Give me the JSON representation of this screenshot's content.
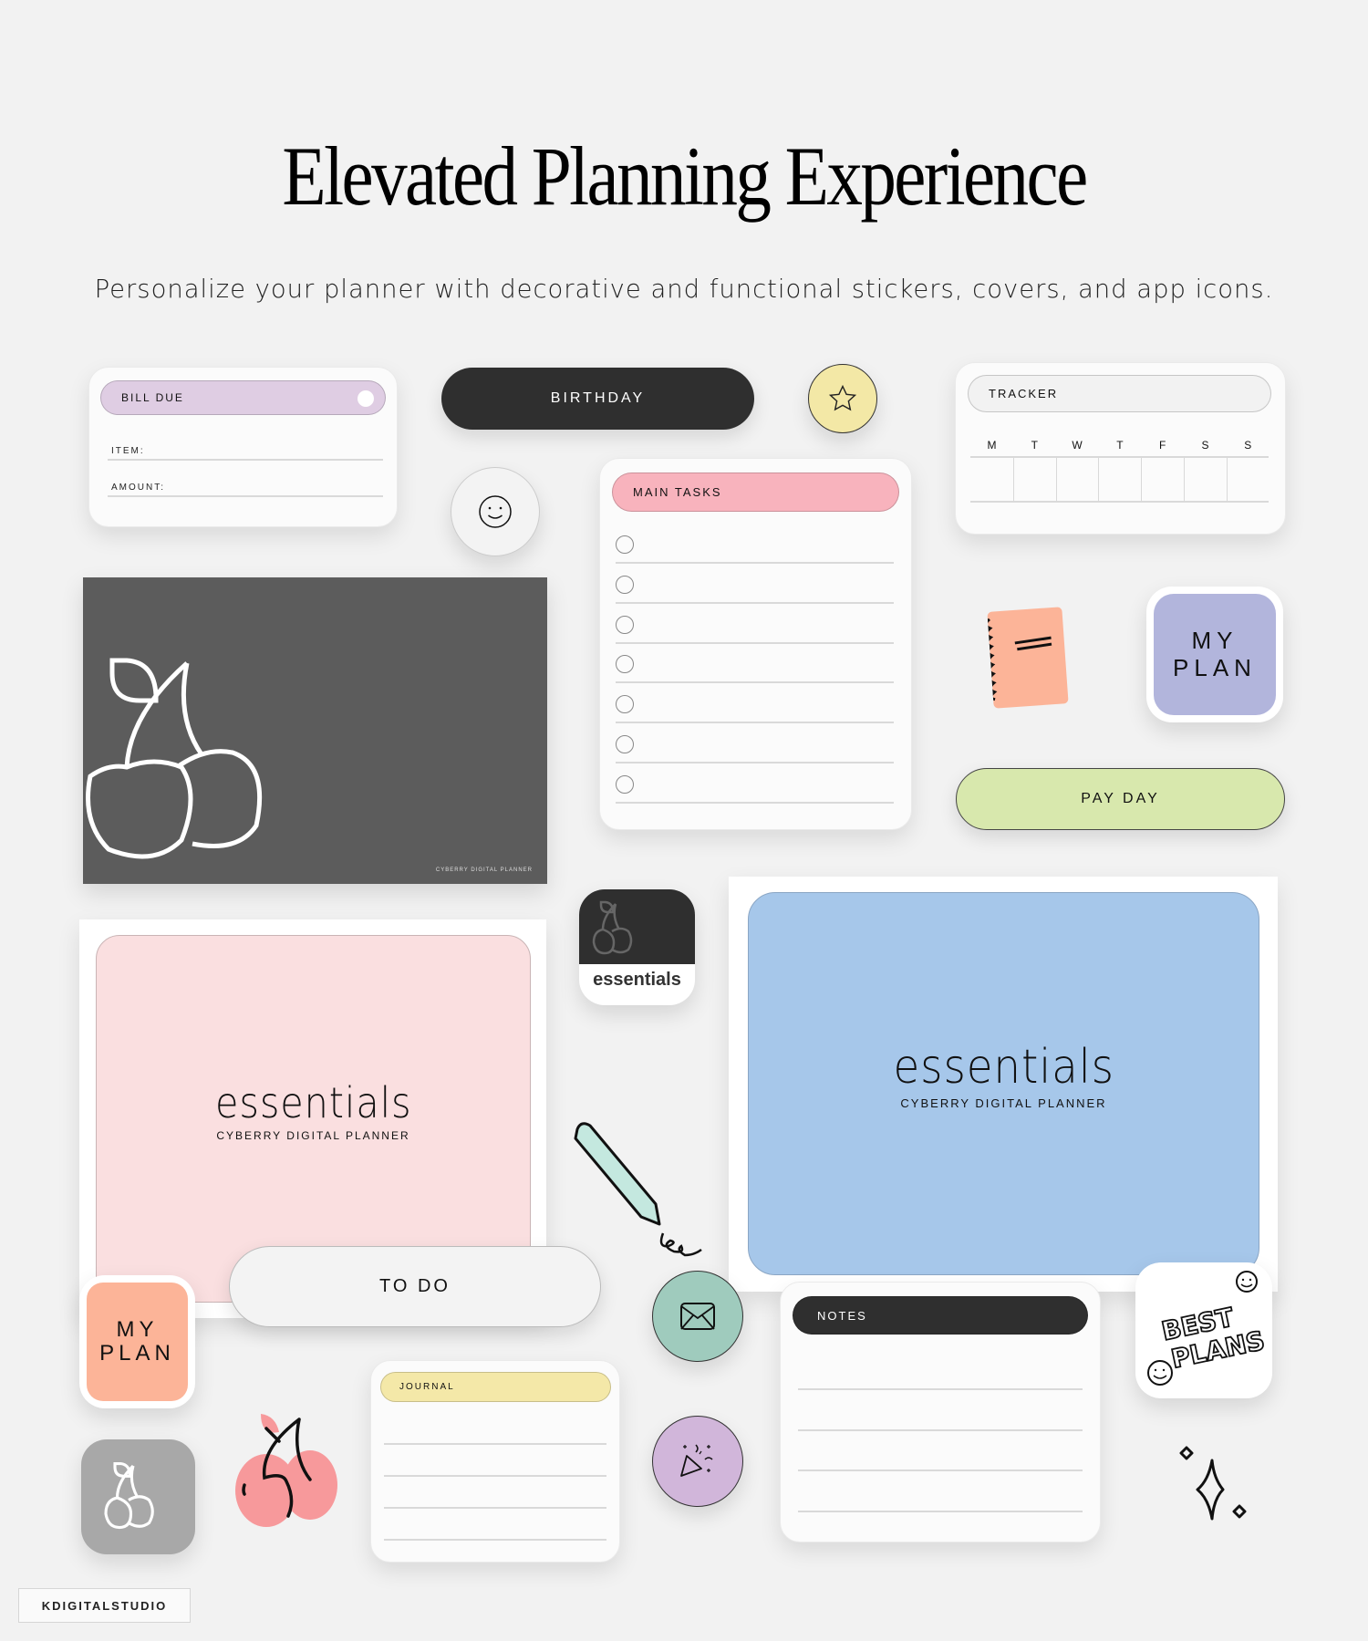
{
  "header": {
    "title": "Elevated Planning Experience",
    "subtitle": "Personalize your planner with decorative and functional stickers, covers, and app icons."
  },
  "widgets": {
    "bill_due": {
      "title": "BILL DUE",
      "fields": [
        "ITEM:",
        "AMOUNT:"
      ],
      "color": "#dfcde3"
    },
    "birthday": {
      "label": "BIRTHDAY",
      "color": "#2f2f2f"
    },
    "star_sticker": {
      "icon": "star-icon",
      "color": "#f3e8a6"
    },
    "smiley_sticker": {
      "icon": "smiley-icon",
      "color": "#f2f2f2"
    },
    "main_tasks": {
      "title": "MAIN TASKS",
      "rows": 7,
      "color": "#f8b3bd"
    },
    "tracker": {
      "title": "TRACKER",
      "days": [
        "M",
        "T",
        "W",
        "T",
        "F",
        "S",
        "S"
      ]
    },
    "dark_cover": {
      "caption": "CYBERRY DIGITAL PLANNER",
      "color": "#5c5c5c"
    },
    "notebook_sticker": {
      "icon": "notebook-icon",
      "color": "#fcb498"
    },
    "my_plan_purple": {
      "line1": "MY",
      "line2": "PLAN",
      "color": "#b2b5dc"
    },
    "pay_day": {
      "label": "PAY DAY",
      "color": "#d8e8ad"
    },
    "pink_cover": {
      "title": "essentials",
      "caption": "CYBERRY DIGITAL PLANNER",
      "color": "#fadfe0"
    },
    "essentials_app": {
      "label": "essentials",
      "color": "#2f2f2f"
    },
    "blue_cover": {
      "title": "essentials",
      "caption": "CYBERRY DIGITAL PLANNER",
      "color": "#a6c7ea"
    },
    "my_plan_orange": {
      "line1": "MY",
      "line2": "PLAN",
      "color": "#fcb498"
    },
    "to_do": {
      "label": "TO DO"
    },
    "mail_sticker": {
      "icon": "mail-icon",
      "color": "#9fcbbd"
    },
    "party_sticker": {
      "icon": "party-popper-icon",
      "color": "#d1b6da"
    },
    "notes": {
      "title": "NOTES",
      "rows": 4,
      "color": "#2f2f2f"
    },
    "journal": {
      "title": "JOURNAL",
      "rows": 4,
      "color": "#f4e8a8"
    },
    "best_plans": {
      "line1": "BEST",
      "line2": "PLANS"
    },
    "cherry_app": {
      "icon": "cherry-icon",
      "color": "#a8a8a8"
    },
    "cherry_sticker": {
      "icon": "cherry-icon",
      "color": "#f7999b"
    },
    "sparkles": {
      "icon": "sparkles-icon"
    }
  },
  "footer": {
    "brand": "KDIGITALSTUDIO"
  }
}
